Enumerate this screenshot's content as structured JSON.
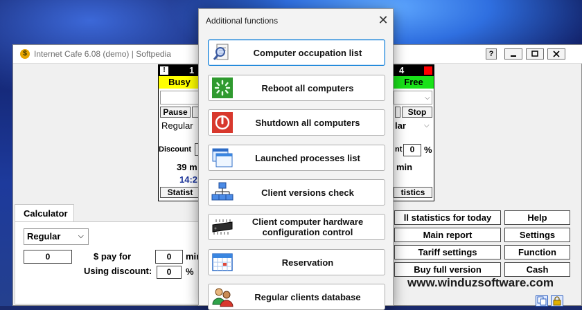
{
  "window": {
    "title": "Internet Cafe 6.08 (demo)   |   Softpedia",
    "help_button": "?"
  },
  "panels": {
    "left": {
      "warn": "!",
      "number": "1",
      "status": "Busy",
      "pause_label": "Pause",
      "tariff": "Regular",
      "discount_label": "Discount",
      "time_partial": "39 m",
      "clock_partial": "14:2",
      "stats_partial": "Statist"
    },
    "right": {
      "number": "4",
      "status": "Free",
      "stop_label": "Stop",
      "tariff_partial": "lar",
      "discount_partial": "nt",
      "discount_value": "0",
      "percent": "%",
      "time_partial": "min",
      "stats_partial": "tistics"
    }
  },
  "calculator": {
    "tab_label": "Calculator",
    "tariff": "Regular",
    "amount": "0",
    "pay_for_label": "$ pay for",
    "minutes_value": "0",
    "minutes_label_partial": "min",
    "discount_label": "Using discount:",
    "discount_value": "0",
    "percent": "%"
  },
  "right_buttons": {
    "stats_today": "ll statistics for today",
    "help": "Help",
    "main_report": "Main report",
    "settings": "Settings",
    "tariff_settings": "Tariff settings",
    "function": "Function",
    "buy": "Buy full version",
    "cash": "Cash"
  },
  "watermark": "www.winduzsoftware.com",
  "dialog": {
    "title": "Additional functions",
    "close_glyph": "✕",
    "items": [
      {
        "label": "Computer occupation list",
        "icon": "magnifier-document-icon"
      },
      {
        "label": "Reboot all computers",
        "icon": "reboot-icon"
      },
      {
        "label": "Shutdown all computers",
        "icon": "power-icon"
      },
      {
        "label": "Launched processes list",
        "icon": "windows-list-icon"
      },
      {
        "label": "Client versions check",
        "icon": "network-icon"
      },
      {
        "label": "Client computer hardware configuration control",
        "icon": "chip-icon"
      },
      {
        "label": "Reservation",
        "icon": "calendar-icon"
      },
      {
        "label": "Regular clients database",
        "icon": "users-icon"
      }
    ]
  },
  "colors": {
    "busy": "#ffff00",
    "free": "#19e319",
    "focus_border": "#0078d7"
  }
}
